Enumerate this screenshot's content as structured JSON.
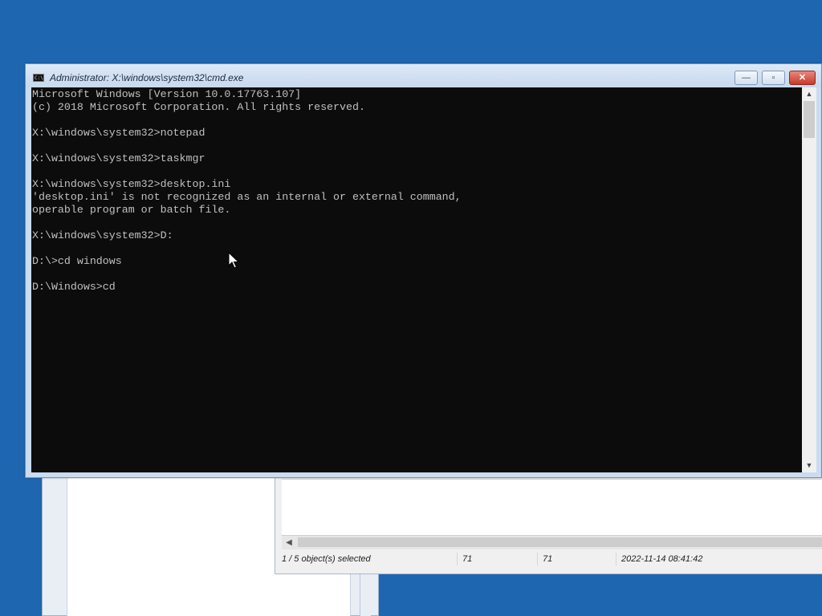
{
  "cmd_window": {
    "title": "Administrator: X:\\windows\\system32\\cmd.exe",
    "icon_label": "C:\\",
    "buttons": {
      "minimize": "—",
      "maximize": "▫",
      "close": "✕"
    },
    "console_lines": [
      "Microsoft Windows [Version 10.0.17763.107]",
      "(c) 2018 Microsoft Corporation. All rights reserved.",
      "",
      "X:\\windows\\system32>notepad",
      "",
      "X:\\windows\\system32>taskmgr",
      "",
      "X:\\windows\\system32>desktop.ini",
      "'desktop.ini' is not recognized as an internal or external command,",
      "operable program or batch file.",
      "",
      "X:\\windows\\system32>D:",
      "",
      "D:\\>cd windows",
      "",
      "D:\\Windows>cd"
    ],
    "scroll_icons": {
      "up": "▲",
      "down": "▼"
    }
  },
  "details_window": {
    "scroll_left": "◀",
    "status": {
      "selection": "1 / 5 object(s) selected",
      "value1": "71",
      "value2": "71",
      "datetime": "2022-11-14 08:41:42"
    }
  },
  "colors": {
    "desktop": "#1e66b0",
    "console_bg": "#0c0c0c",
    "console_text": "#c0c0c0"
  }
}
